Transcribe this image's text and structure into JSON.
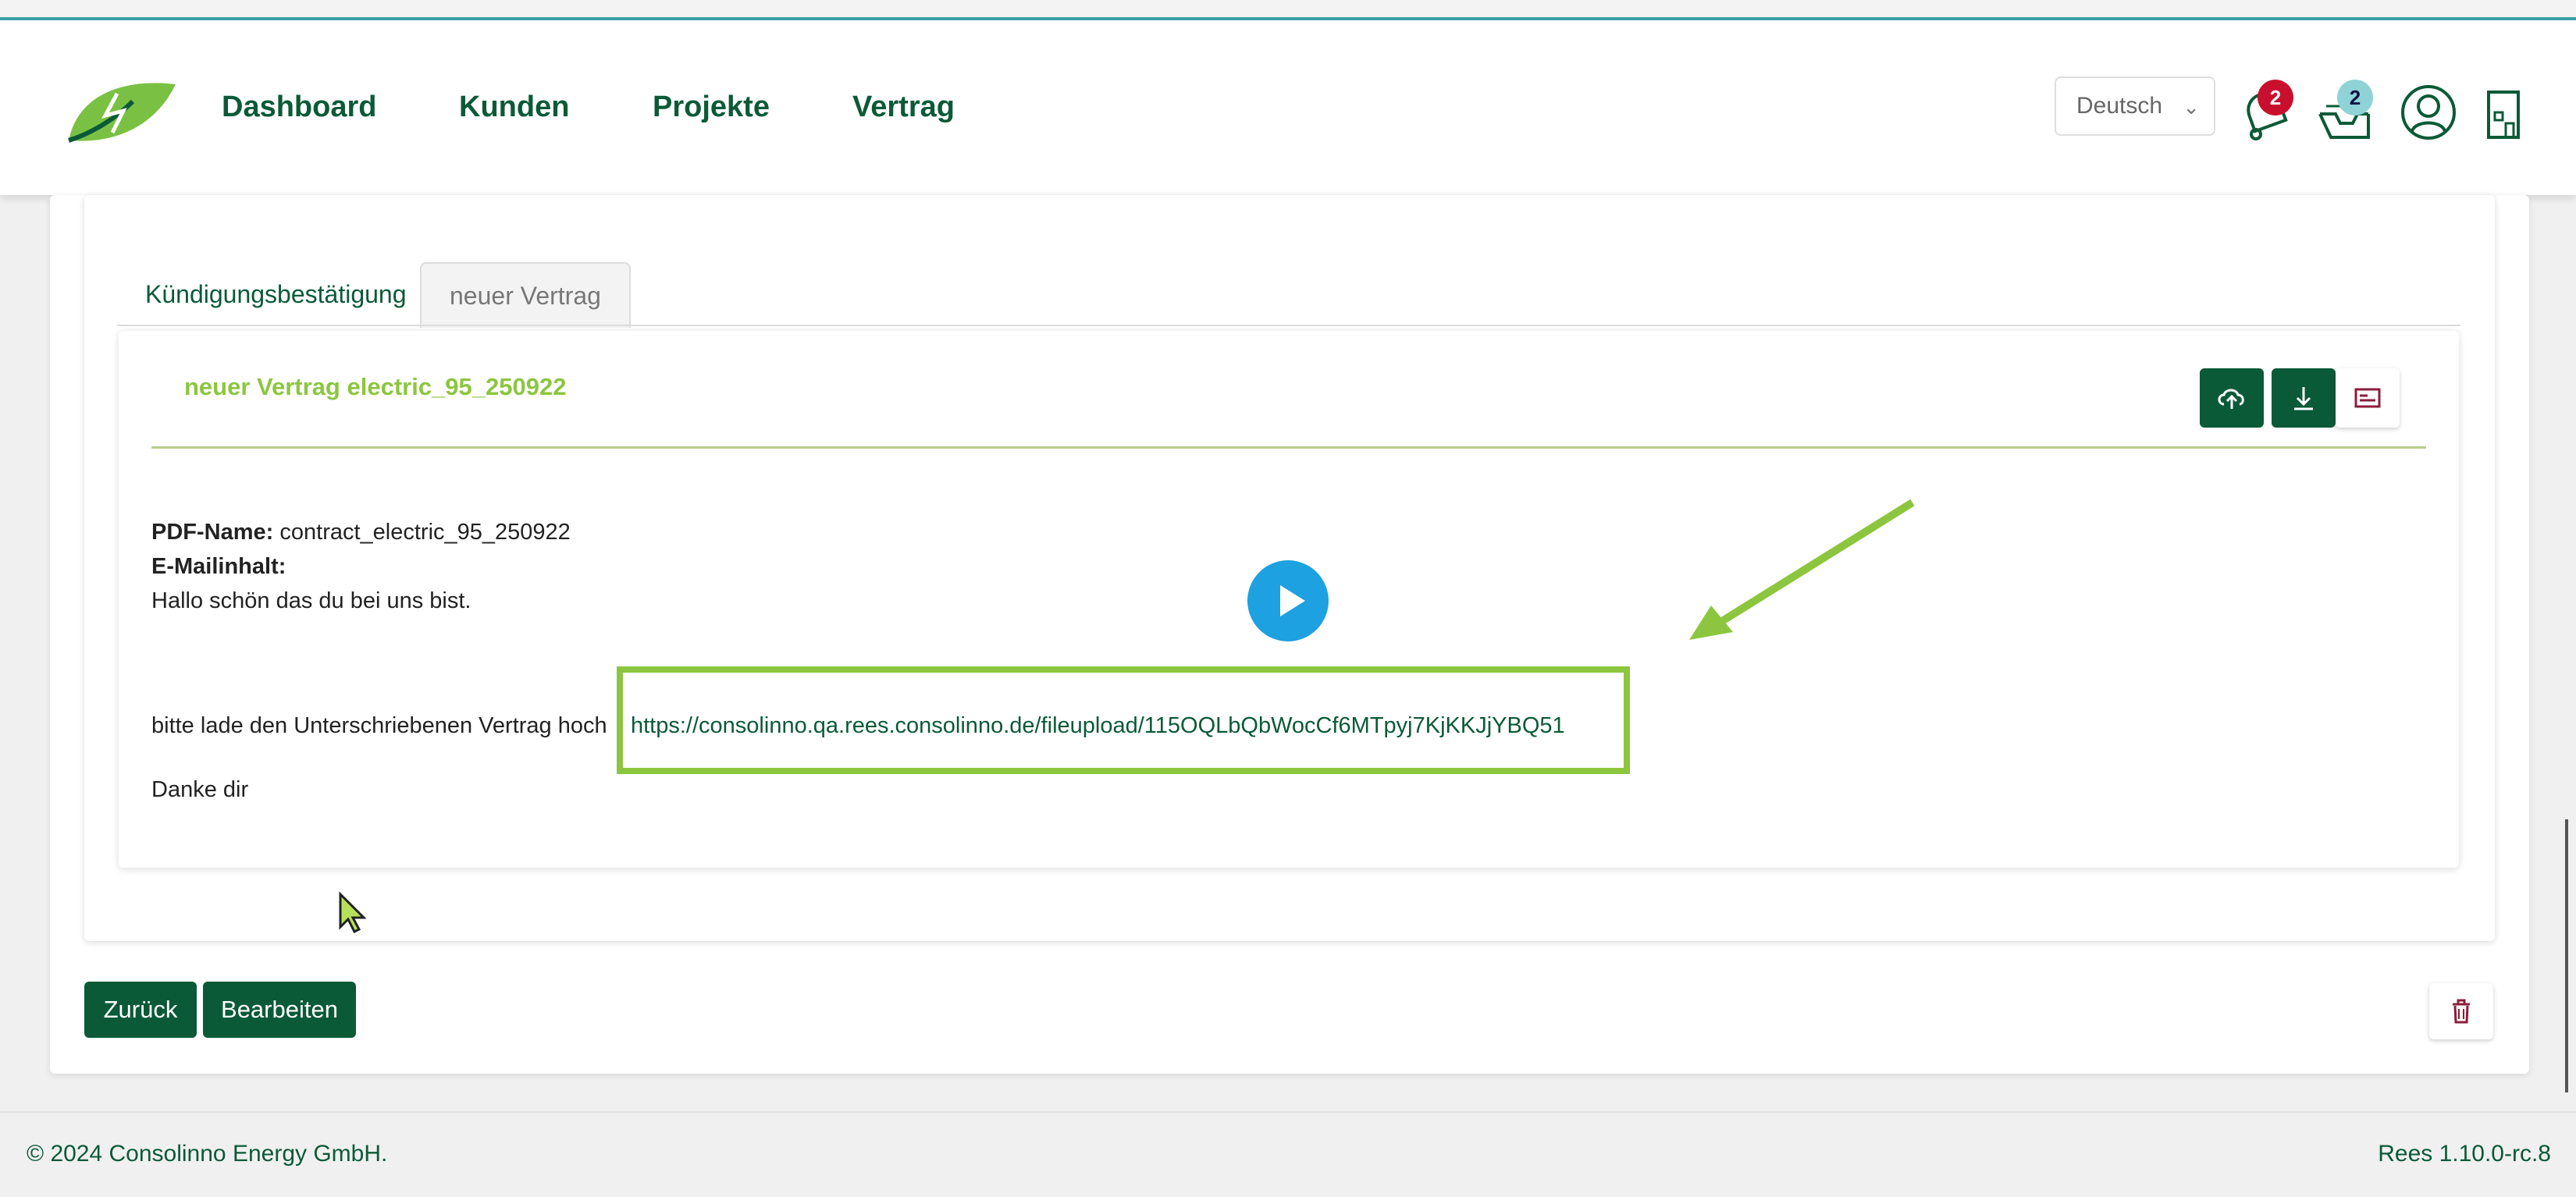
{
  "nav": {
    "links": [
      "Dashboard",
      "Kunden",
      "Projekte",
      "Vertrag"
    ],
    "language": "Deutsch",
    "notification_count": "2",
    "messages_count": "2"
  },
  "tabs": [
    "Kündigungsbestätigung",
    "neuer Vertrag"
  ],
  "contract": {
    "title": "neuer Vertrag electric_95_250922",
    "pdf_name_label": "PDF-Name:",
    "pdf_name": "contract_electric_95_250922",
    "email_label": "E-Mailinhalt:",
    "greeting": "Hallo schön das du bei uns bist.",
    "upload_text": "bitte lade den Unterschriebenen Vertrag hoch",
    "upload_link": "https://consolinno.qa.rees.consolinno.de/fileupload/115OQLbQbWocCf6MTpyj7KjKKJjYBQ51",
    "thanks": "Danke dir"
  },
  "actions": {
    "back": "Zurück",
    "edit": "Bearbeiten"
  },
  "footer": {
    "copyright": "© 2024 Consolinno Energy GmbH.",
    "version": "Rees 1.10.0-rc.8"
  },
  "icons": [
    "leaf-logo",
    "bell-icon",
    "inbox-icon",
    "user-icon",
    "building-icon",
    "upload-cloud-icon",
    "download-icon",
    "email-card-icon",
    "trash-icon",
    "play-icon",
    "arrow-annotation",
    "mouse-cursor"
  ],
  "colors": {
    "brand_green": "#0b5a37",
    "accent_lime": "#8cc63f",
    "badge_red": "#c8102e",
    "play_blue": "#1da1e0"
  }
}
